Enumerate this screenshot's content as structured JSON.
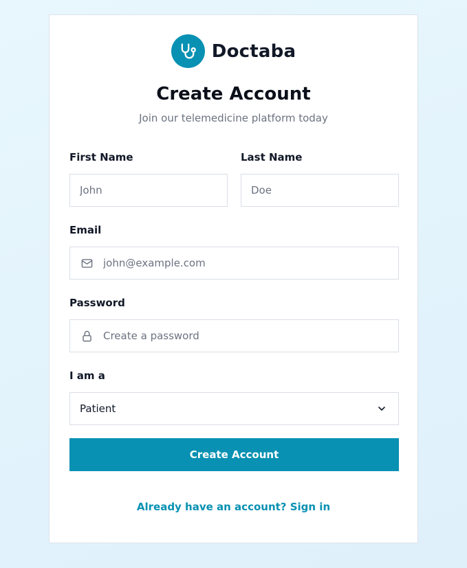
{
  "brand": {
    "name": "Doctaba",
    "logo_icon": "stethoscope-icon",
    "accent_color": "#0891b2"
  },
  "form": {
    "title": "Create Account",
    "subtitle": "Join our telemedicine platform today",
    "first_name": {
      "label": "First Name",
      "placeholder": "John",
      "value": ""
    },
    "last_name": {
      "label": "Last Name",
      "placeholder": "Doe",
      "value": ""
    },
    "email": {
      "label": "Email",
      "placeholder": "john@example.com",
      "value": "",
      "icon": "mail-icon"
    },
    "password": {
      "label": "Password",
      "placeholder": "Create a password",
      "value": "",
      "icon": "lock-icon"
    },
    "role": {
      "label": "I am a",
      "selected": "Patient",
      "icon": "chevron-down-icon"
    },
    "submit_label": "Create Account",
    "signin_link": "Already have an account? Sign in"
  }
}
